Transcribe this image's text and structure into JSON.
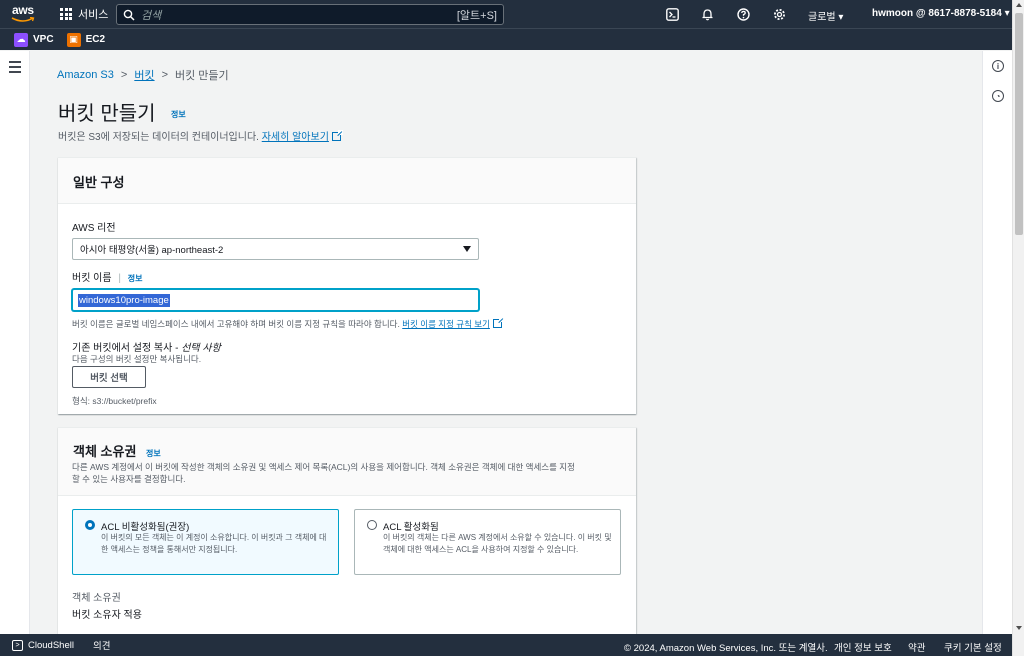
{
  "topnav": {
    "logo": "aws",
    "services_label": "서비스",
    "search_placeholder": "검색",
    "search_shortcut": "[알트+S]",
    "region": "글로벌 ▾",
    "account": "hwmoon @ 8617-8878-5184 ▾"
  },
  "favorites": [
    {
      "label": "VPC",
      "icon": "vpc-icon",
      "color": "#8c4fff"
    },
    {
      "label": "EC2",
      "icon": "ec2-icon",
      "color": "#ed7100"
    }
  ],
  "breadcrumb": {
    "root": "Amazon S3",
    "mid": "버킷",
    "current": "버킷 만들기"
  },
  "page": {
    "title": "버킷 만들기",
    "info": "정보",
    "desc": "버킷은 S3에 저장되는 데이터의 컨테이너입니다.",
    "learn_more": "자세히 알아보기"
  },
  "general": {
    "title": "일반 구성",
    "region_label": "AWS 리전",
    "region_value": "아시아 태평양(서울) ap-northeast-2",
    "name_label": "버킷 이름",
    "name_info": "정보",
    "name_value": "windows10pro-image",
    "name_hint": "버킷 이름은 글로벌 네임스페이스 내에서 고유해야 하며 버킷 이름 지정 규칙을 따라야 합니다.",
    "name_rules_link": "버킷 이름 지정 규칙 보기",
    "copy_label": "기존 버킷에서 설정 복사 - ",
    "copy_optional": "선택 사항",
    "copy_desc": "다음 구성의 버킷 설정만 복사됩니다.",
    "choose_button": "버킷 선택",
    "format_hint": "형식: s3://bucket/prefix"
  },
  "ownership": {
    "title": "객체 소유권",
    "info": "정보",
    "desc_line1": "다른 AWS 계정에서 이 버킷에 작성한 객체의 소유권 및 액세스 제어 목록(ACL)의 사용을 제어합니다. 객체 소유권은 객체에 대한 액세스를 지정",
    "desc_line2": "할 수 있는 사용자를 결정합니다.",
    "options": [
      {
        "title": "ACL 비활성화됨(권장)",
        "desc": "이 버킷의 모든 객체는 이 계정이 소유합니다. 이 버킷과 그 객체에 대한 액세스는 정책을 통해서만 지정됩니다.",
        "selected": true
      },
      {
        "title": "ACL 활성화됨",
        "desc": "이 버킷의 객체는 다른 AWS 계정에서 소유할 수 있습니다. 이 버킷 및 객체에 대한 액세스는 ACL을 사용하여 지정할 수 있습니다.",
        "selected": false
      }
    ],
    "owner_label": "객체 소유권",
    "owner_value": "버킷 소유자 적용"
  },
  "footer": {
    "cloudshell": "CloudShell",
    "feedback": "의견",
    "copyright": "© 2024, Amazon Web Services, Inc. 또는 계열사.",
    "privacy": "개인 정보 보호",
    "terms": "약관",
    "cookies": "쿠키 기본 설정"
  }
}
